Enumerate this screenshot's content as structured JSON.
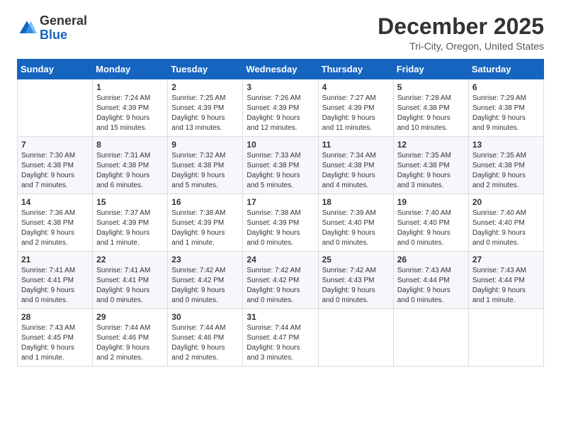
{
  "logo": {
    "general": "General",
    "blue": "Blue"
  },
  "title": "December 2025",
  "location": "Tri-City, Oregon, United States",
  "days_of_week": [
    "Sunday",
    "Monday",
    "Tuesday",
    "Wednesday",
    "Thursday",
    "Friday",
    "Saturday"
  ],
  "weeks": [
    [
      {
        "day": "",
        "info": ""
      },
      {
        "day": "1",
        "info": "Sunrise: 7:24 AM\nSunset: 4:39 PM\nDaylight: 9 hours\nand 15 minutes."
      },
      {
        "day": "2",
        "info": "Sunrise: 7:25 AM\nSunset: 4:39 PM\nDaylight: 9 hours\nand 13 minutes."
      },
      {
        "day": "3",
        "info": "Sunrise: 7:26 AM\nSunset: 4:39 PM\nDaylight: 9 hours\nand 12 minutes."
      },
      {
        "day": "4",
        "info": "Sunrise: 7:27 AM\nSunset: 4:39 PM\nDaylight: 9 hours\nand 11 minutes."
      },
      {
        "day": "5",
        "info": "Sunrise: 7:28 AM\nSunset: 4:38 PM\nDaylight: 9 hours\nand 10 minutes."
      },
      {
        "day": "6",
        "info": "Sunrise: 7:29 AM\nSunset: 4:38 PM\nDaylight: 9 hours\nand 9 minutes."
      }
    ],
    [
      {
        "day": "7",
        "info": "Sunrise: 7:30 AM\nSunset: 4:38 PM\nDaylight: 9 hours\nand 7 minutes."
      },
      {
        "day": "8",
        "info": "Sunrise: 7:31 AM\nSunset: 4:38 PM\nDaylight: 9 hours\nand 6 minutes."
      },
      {
        "day": "9",
        "info": "Sunrise: 7:32 AM\nSunset: 4:38 PM\nDaylight: 9 hours\nand 5 minutes."
      },
      {
        "day": "10",
        "info": "Sunrise: 7:33 AM\nSunset: 4:38 PM\nDaylight: 9 hours\nand 5 minutes."
      },
      {
        "day": "11",
        "info": "Sunrise: 7:34 AM\nSunset: 4:38 PM\nDaylight: 9 hours\nand 4 minutes."
      },
      {
        "day": "12",
        "info": "Sunrise: 7:35 AM\nSunset: 4:38 PM\nDaylight: 9 hours\nand 3 minutes."
      },
      {
        "day": "13",
        "info": "Sunrise: 7:35 AM\nSunset: 4:38 PM\nDaylight: 9 hours\nand 2 minutes."
      }
    ],
    [
      {
        "day": "14",
        "info": "Sunrise: 7:36 AM\nSunset: 4:38 PM\nDaylight: 9 hours\nand 2 minutes."
      },
      {
        "day": "15",
        "info": "Sunrise: 7:37 AM\nSunset: 4:39 PM\nDaylight: 9 hours\nand 1 minute."
      },
      {
        "day": "16",
        "info": "Sunrise: 7:38 AM\nSunset: 4:39 PM\nDaylight: 9 hours\nand 1 minute."
      },
      {
        "day": "17",
        "info": "Sunrise: 7:38 AM\nSunset: 4:39 PM\nDaylight: 9 hours\nand 0 minutes."
      },
      {
        "day": "18",
        "info": "Sunrise: 7:39 AM\nSunset: 4:40 PM\nDaylight: 9 hours\nand 0 minutes."
      },
      {
        "day": "19",
        "info": "Sunrise: 7:40 AM\nSunset: 4:40 PM\nDaylight: 9 hours\nand 0 minutes."
      },
      {
        "day": "20",
        "info": "Sunrise: 7:40 AM\nSunset: 4:40 PM\nDaylight: 9 hours\nand 0 minutes."
      }
    ],
    [
      {
        "day": "21",
        "info": "Sunrise: 7:41 AM\nSunset: 4:41 PM\nDaylight: 9 hours\nand 0 minutes."
      },
      {
        "day": "22",
        "info": "Sunrise: 7:41 AM\nSunset: 4:41 PM\nDaylight: 9 hours\nand 0 minutes."
      },
      {
        "day": "23",
        "info": "Sunrise: 7:42 AM\nSunset: 4:42 PM\nDaylight: 9 hours\nand 0 minutes."
      },
      {
        "day": "24",
        "info": "Sunrise: 7:42 AM\nSunset: 4:42 PM\nDaylight: 9 hours\nand 0 minutes."
      },
      {
        "day": "25",
        "info": "Sunrise: 7:42 AM\nSunset: 4:43 PM\nDaylight: 9 hours\nand 0 minutes."
      },
      {
        "day": "26",
        "info": "Sunrise: 7:43 AM\nSunset: 4:44 PM\nDaylight: 9 hours\nand 0 minutes."
      },
      {
        "day": "27",
        "info": "Sunrise: 7:43 AM\nSunset: 4:44 PM\nDaylight: 9 hours\nand 1 minute."
      }
    ],
    [
      {
        "day": "28",
        "info": "Sunrise: 7:43 AM\nSunset: 4:45 PM\nDaylight: 9 hours\nand 1 minute."
      },
      {
        "day": "29",
        "info": "Sunrise: 7:44 AM\nSunset: 4:46 PM\nDaylight: 9 hours\nand 2 minutes."
      },
      {
        "day": "30",
        "info": "Sunrise: 7:44 AM\nSunset: 4:46 PM\nDaylight: 9 hours\nand 2 minutes."
      },
      {
        "day": "31",
        "info": "Sunrise: 7:44 AM\nSunset: 4:47 PM\nDaylight: 9 hours\nand 3 minutes."
      },
      {
        "day": "",
        "info": ""
      },
      {
        "day": "",
        "info": ""
      },
      {
        "day": "",
        "info": ""
      }
    ]
  ]
}
